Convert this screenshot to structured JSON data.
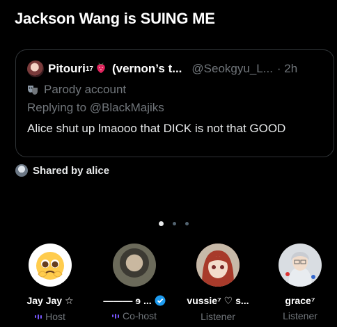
{
  "space": {
    "title": "Jackson Wang is SUING ME"
  },
  "quote": {
    "author_name": "Pitouri",
    "author_sup": "17",
    "author_suffix": "(vernon’s t...",
    "handle": "@Seokgyu_L...",
    "time": "· 2h",
    "parody_label": "Parody account",
    "replying_to": "Replying to @BlackMajiks",
    "text": "Alice shut up lmaooo that DICK is not that GOOD"
  },
  "shared_by": "Shared by alice",
  "pager": {
    "count": 3,
    "active": 0
  },
  "participants": [
    {
      "name": "Jay Jay ☆",
      "role": "Host",
      "avatar": "pleading-emoji-avatar"
    },
    {
      "name": "——— ɘ ...",
      "role": "Co-host",
      "avatar": "photo-avatar",
      "verified": true
    },
    {
      "name": "vussie⁷ ♡ s...",
      "role": "Listener",
      "avatar": "anime-avatar"
    },
    {
      "name": "grace⁷",
      "role": "Listener",
      "avatar": "photo-avatar-2"
    }
  ],
  "colors": {
    "background": "#000000",
    "text": "#e7e9ea",
    "muted": "#71767b",
    "accent": "#1d9bf0",
    "speaking": "#7856ff"
  }
}
